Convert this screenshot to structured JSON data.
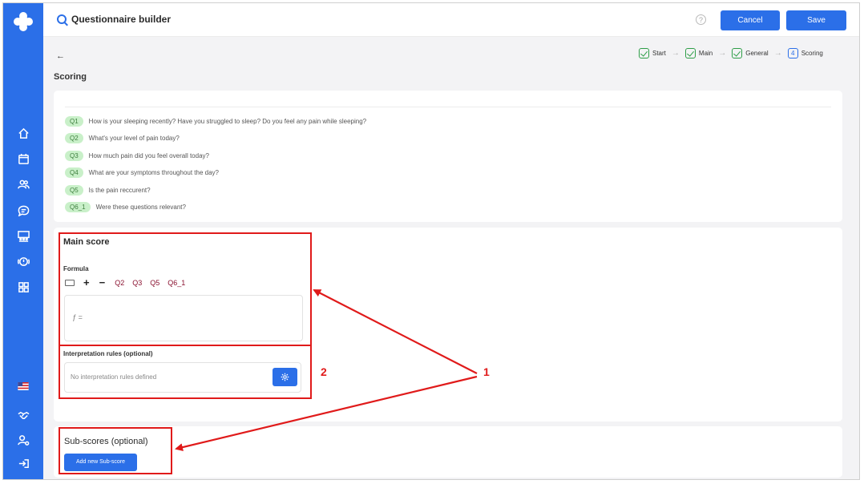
{
  "header": {
    "title": "Questionnaire builder",
    "help": "?",
    "cancel_label": "Cancel",
    "save_label": "Save"
  },
  "nav": {
    "back": "←",
    "page_title": "Scoring",
    "steps": [
      {
        "label": "Start",
        "done": true
      },
      {
        "label": "Main",
        "done": true
      },
      {
        "label": "General",
        "done": true
      },
      {
        "label": "Scoring",
        "number": "4",
        "done": false
      }
    ]
  },
  "questions": [
    {
      "tag": "Q1",
      "text": "How is your sleeping recently? Have you struggled to sleep? Do you feel any pain while sleeping?"
    },
    {
      "tag": "Q2",
      "text": "What's your level of pain today?"
    },
    {
      "tag": "Q3",
      "text": "How much pain did you feel overall today?"
    },
    {
      "tag": "Q4",
      "text": "What are your symptoms throughout the day?"
    },
    {
      "tag": "Q5",
      "text": "Is the pain reccurent?"
    },
    {
      "tag": "Q6_1",
      "text": "Were these questions relevant?"
    }
  ],
  "main_score": {
    "title": "Main score",
    "formula_label": "Formula",
    "plus": "+",
    "minus": "−",
    "formula_vars": [
      "Q2",
      "Q3",
      "Q5",
      "Q6_1"
    ],
    "fx": "ƒ =",
    "interp_label": "Interpretation rules (optional)",
    "interp_empty": "No interpretation rules defined"
  },
  "sub_scores": {
    "title": "Sub-scores (optional)",
    "add_label": "Add new Sub-score"
  },
  "annotations": {
    "label_1": "1",
    "label_2": "2",
    "color": "#e01a1a"
  },
  "colors": {
    "brand": "#2b6fe8",
    "tag_bg": "#c9f0c9",
    "formula_var": "#8a1230"
  }
}
